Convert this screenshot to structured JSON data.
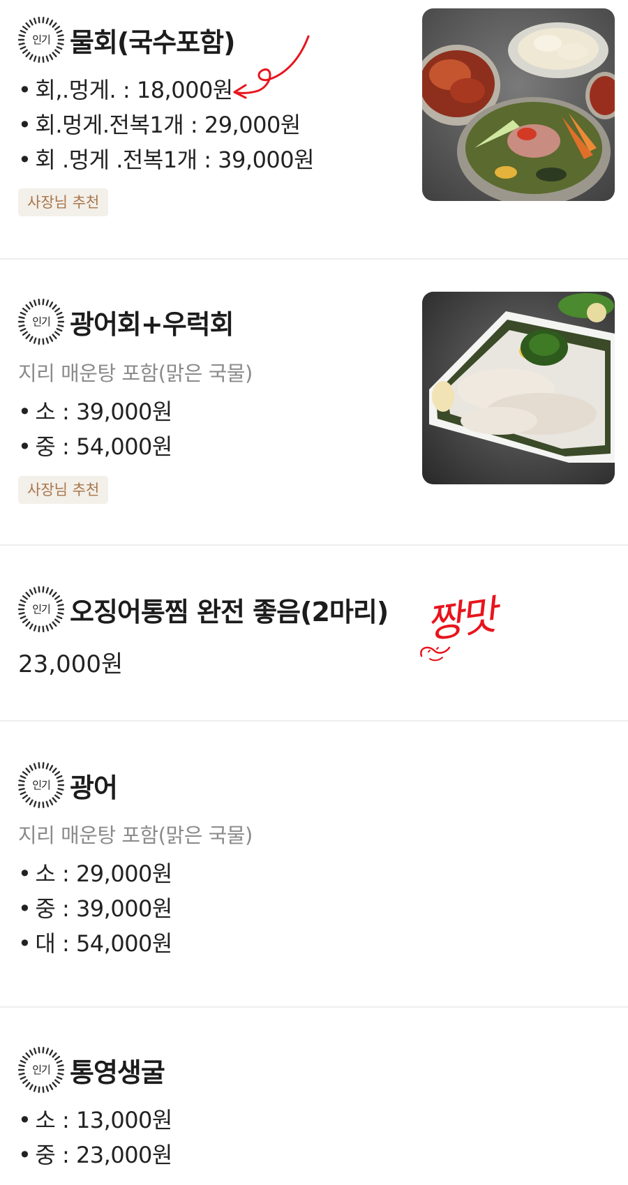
{
  "items": [
    {
      "badge": "인기",
      "name": "물회(국수포함)",
      "lines": [
        "회,.멍게. : 18,000원",
        "회.멍게.전복1개 : 29,000원",
        "회 .멍게 .전복1개 : 39,000원"
      ],
      "tag": "사장님 추천",
      "image": "mulhoe-photo"
    },
    {
      "badge": "인기",
      "name": "광어회+우럭회",
      "description": "지리 매운탕 포함(맑은 국물)",
      "lines": [
        "소 : 39,000원",
        "중 : 54,000원"
      ],
      "tag": "사장님 추천",
      "image": "sashimi-platter-photo"
    },
    {
      "badge": "인기",
      "name": "오징어통찜 완전 좋음(2마리)",
      "price": "23,000원"
    },
    {
      "badge": "인기",
      "name": "광어",
      "description": "지리 매운탕 포함(맑은 국물)",
      "lines": [
        "소 : 29,000원",
        "중 : 39,000원",
        "대 : 54,000원"
      ]
    },
    {
      "badge": "인기",
      "name": "통영생굴",
      "lines": [
        "소 : 13,000원",
        "중 : 23,000원"
      ]
    }
  ],
  "annotations": {
    "handwritten_note": "짱맛",
    "note_color": "#e8141c",
    "arrow_color": "#e8141c"
  },
  "colors": {
    "tag_bg": "#f3efe9",
    "tag_text": "#a8754a",
    "description": "#8a8a8a"
  }
}
